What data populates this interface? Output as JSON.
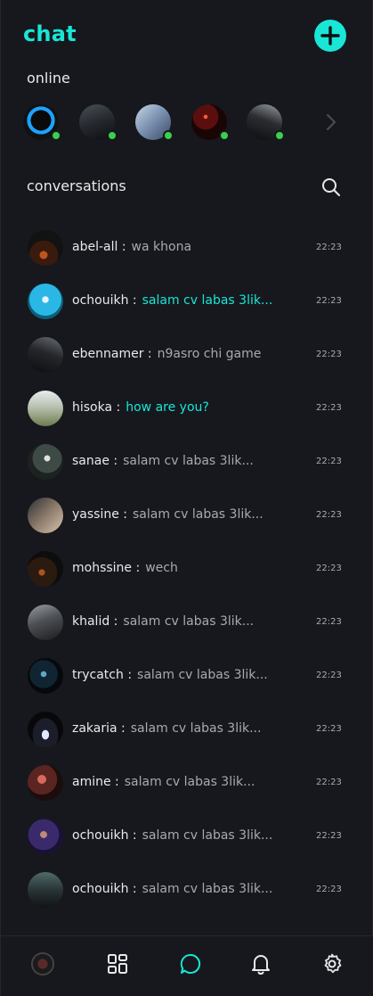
{
  "app": {
    "title": "chat"
  },
  "colors": {
    "accent": "#19e6d6",
    "background": "#16181d",
    "online": "#3ccf4e"
  },
  "online": {
    "title": "online",
    "users": [
      {
        "avatar": "avatar-blue-ring"
      },
      {
        "avatar": "avatar-dark-portrait"
      },
      {
        "avatar": "avatar-light-portrait"
      },
      {
        "avatar": "avatar-red-glow"
      },
      {
        "avatar": "avatar-dark-hooded"
      }
    ],
    "next_icon": "chevron-right-icon"
  },
  "conversations": {
    "title": "conversations",
    "search_icon": "search-icon",
    "items": [
      {
        "name": "abel-all",
        "message": "wa khona",
        "time": "22:23",
        "unread": false
      },
      {
        "name": "ochouikh",
        "message": "salam cv labas 3lik...",
        "time": "22:23",
        "unread": true
      },
      {
        "name": "ebennamer",
        "message": "n9asro chi game",
        "time": "22:23",
        "unread": false
      },
      {
        "name": "hisoka",
        "message": "how are you?",
        "time": "22:23",
        "unread": true
      },
      {
        "name": "sanae",
        "message": "salam cv labas 3lik...",
        "time": "22:23",
        "unread": false
      },
      {
        "name": "yassine",
        "message": "salam cv labas 3lik...",
        "time": "22:23",
        "unread": false
      },
      {
        "name": "mohssine",
        "message": "wech",
        "time": "22:23",
        "unread": false
      },
      {
        "name": "khalid",
        "message": "salam cv labas 3lik...",
        "time": "22:23",
        "unread": false
      },
      {
        "name": "trycatch",
        "message": "salam cv labas 3lik...",
        "time": "22:23",
        "unread": false
      },
      {
        "name": "zakaria",
        "message": "salam cv labas 3lik...",
        "time": "22:23",
        "unread": false
      },
      {
        "name": "amine",
        "message": "salam cv labas 3lik...",
        "time": "22:23",
        "unread": false
      },
      {
        "name": "ochouikh",
        "message": "salam cv labas 3lik...",
        "time": "22:23",
        "unread": false
      },
      {
        "name": "ochouikh",
        "message": "salam cv labas 3lik...",
        "time": "22:23",
        "unread": false
      }
    ]
  },
  "bottom_nav": {
    "items": [
      {
        "icon": "profile-avatar-icon",
        "active": false
      },
      {
        "icon": "dashboard-grid-icon",
        "active": false
      },
      {
        "icon": "chat-bubble-icon",
        "active": true
      },
      {
        "icon": "bell-icon",
        "active": false
      },
      {
        "icon": "gear-icon",
        "active": false
      }
    ]
  }
}
